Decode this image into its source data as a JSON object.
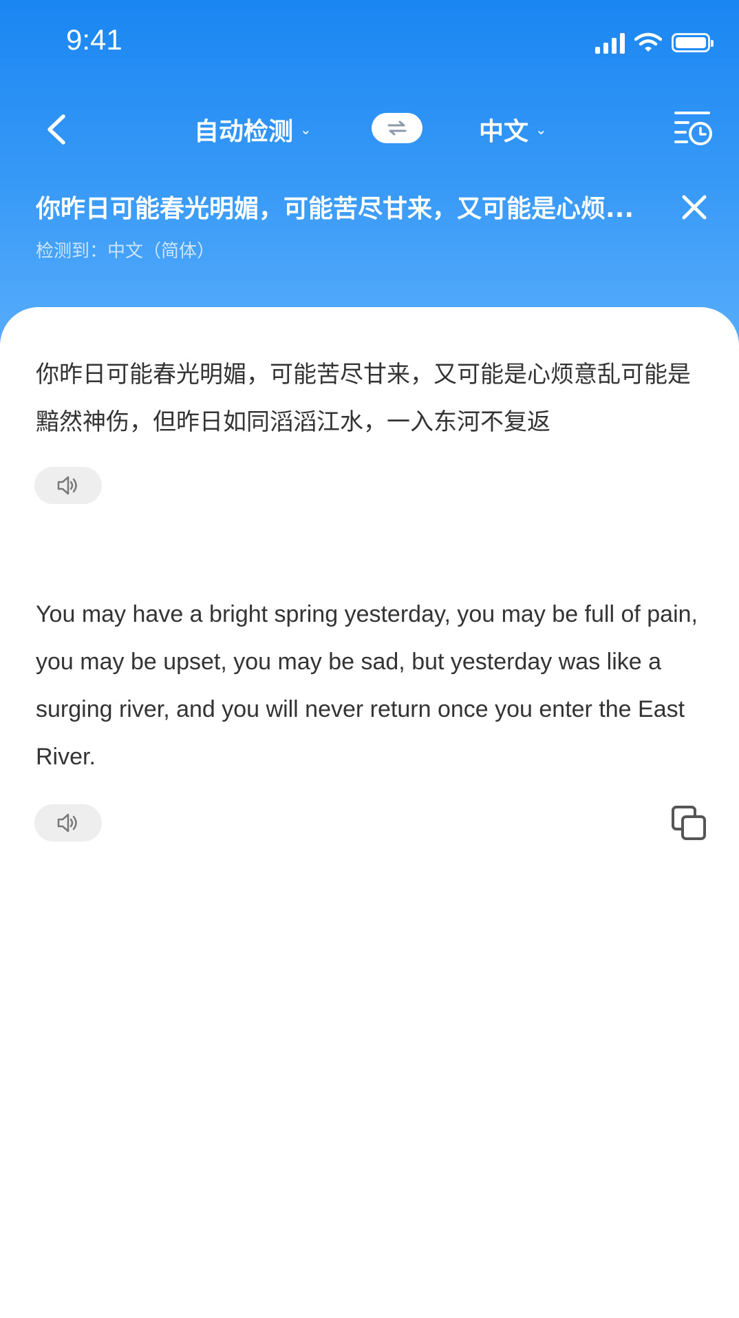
{
  "status_bar": {
    "time": "9:41"
  },
  "nav": {
    "source_language": "自动检测",
    "target_language": "中文",
    "swap_symbol": "⇌",
    "back_icon": "chevron-left-icon",
    "history_icon": "history-clock-icon"
  },
  "source_summary": {
    "text": "你昨日可能春光明媚，可能苦尽甘来，又可能是心烦...",
    "detected_label": "检测到：中文（简体）",
    "close_icon": "close-icon"
  },
  "source": {
    "text": "你昨日可能春光明媚，可能苦尽甘来，又可能是心烦意乱可能是黯然神伤，但昨日如同滔滔江水，一入东河不复返",
    "speaker_icon": "speaker-icon"
  },
  "result": {
    "text": "You may have a bright spring yesterday, you may be full of pain, you may be upset, you may be sad, but yesterday was like a surging river, and you will never return once you enter the East River.",
    "speaker_icon": "speaker-icon",
    "copy_icon": "copy-icon"
  },
  "colors": {
    "header_top": "#1a86f2",
    "header_bottom": "#5aaefb",
    "text_primary": "#333333",
    "button_bg": "#eeeeee"
  }
}
